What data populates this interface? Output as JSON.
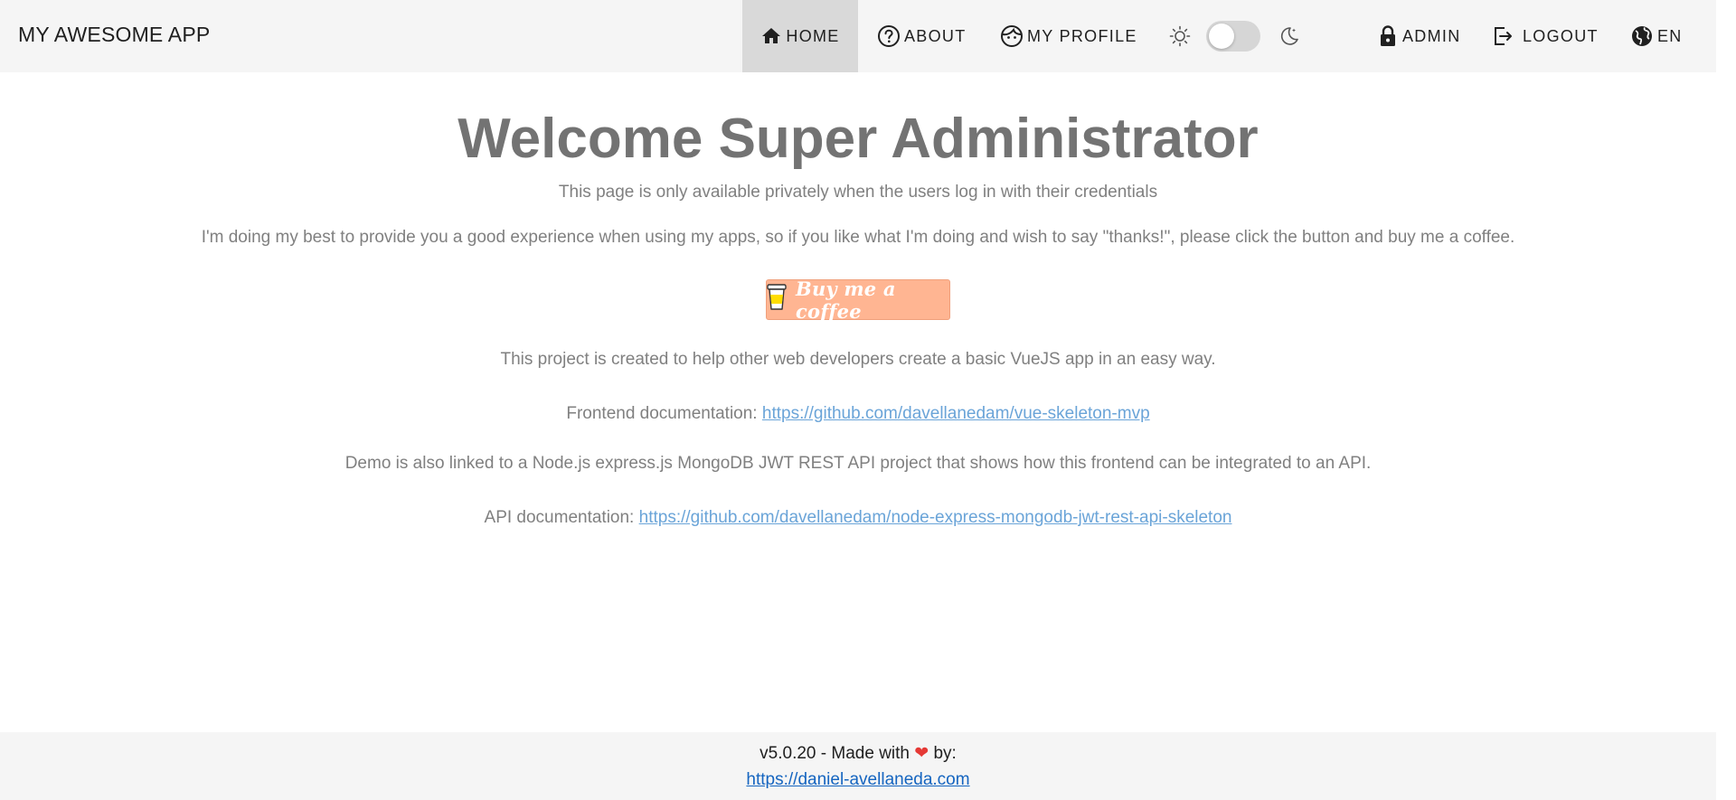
{
  "header": {
    "app_title": "MY AWESOME APP",
    "nav": {
      "home": "HOME",
      "about": "ABOUT",
      "profile": "MY PROFILE",
      "admin": "ADMIN",
      "logout": "LOGOUT",
      "language": "EN"
    },
    "theme_toggle": {
      "dark_mode": false
    }
  },
  "main": {
    "title": "Welcome Super Administrator",
    "subtitle": "This page is only available privately when the users log in with their credentials",
    "thanks_text": "I'm doing my best to provide you a good experience when using my apps, so if you like what I'm doing and wish to say \"thanks!\", please click the button and buy me a coffee.",
    "coffee_button": "Buy me a coffee",
    "project_text": "This project is created to help other web developers create a basic VueJS app in an easy way.",
    "frontend_label": "Frontend documentation: ",
    "frontend_url": "https://github.com/davellanedam/vue-skeleton-mvp",
    "demo_text": "Demo is also linked to a Node.js express.js MongoDB JWT REST API project that shows how this frontend can be integrated to an API.",
    "api_label": "API documentation: ",
    "api_url": "https://github.com/davellanedam/node-express-mongodb-jwt-rest-api-skeleton"
  },
  "footer": {
    "version_prefix": "v5.0.20 - Made with ",
    "heart": "❤",
    "by": " by:",
    "link": "https://daniel-avellaneda.com"
  },
  "colors": {
    "topbar_bg": "#f5f5f5",
    "active_nav_bg": "#d9d9d9",
    "title_gray": "#737373",
    "link_blue": "#6aa4d8",
    "coffee_button_bg": "#ffb592",
    "heart_red": "#e53935"
  }
}
